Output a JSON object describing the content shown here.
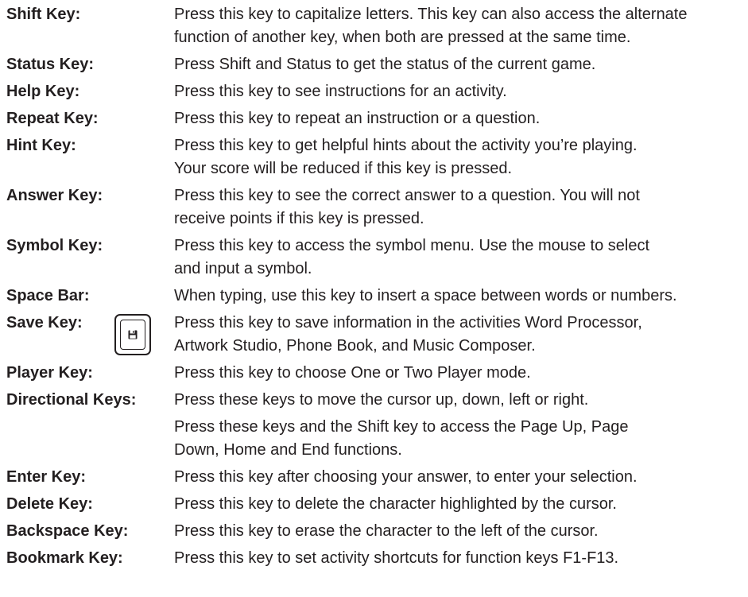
{
  "entries": [
    {
      "term": "Shift Key:",
      "lines": [
        "Press this key to capitalize letters. This key can also access the alternate",
        "function of another key, when both are pressed at the same time."
      ]
    },
    {
      "term": "Status Key:",
      "lines": [
        "Press Shift and Status to get the status of the current game."
      ]
    },
    {
      "term": "Help Key:",
      "lines": [
        "Press this key to see instructions for an activity."
      ]
    },
    {
      "term": "Repeat Key:",
      "lines": [
        "Press this key to repeat an instruction or a question."
      ]
    },
    {
      "term": "Hint Key:",
      "lines": [
        "Press this key to get helpful hints about the activity you’re playing.",
        "Your score will be reduced if this key is pressed."
      ]
    },
    {
      "term": "Answer Key:",
      "lines": [
        "Press this key to see the correct answer to a question. You will not",
        "receive points if this key is pressed."
      ]
    },
    {
      "term": "Symbol Key:",
      "lines": [
        "Press this key to access the symbol menu. Use the mouse to select",
        "and input a symbol."
      ]
    },
    {
      "term": "Space Bar:",
      "lines": [
        "When typing, use this key to insert a space between words or numbers."
      ]
    },
    {
      "term": "Save Key:",
      "lines": [
        "Press this key to save information in the activities Word Processor,",
        "Artwork Studio, Phone Book, and Music Composer."
      ],
      "icon": "floppy-disk-icon"
    },
    {
      "term": "Player Key:",
      "lines": [
        "Press this key to choose One or Two Player mode."
      ]
    },
    {
      "term": "Directional Keys:",
      "lines": [
        "Press these keys to move the cursor up, down, left or right."
      ]
    },
    {
      "term": "",
      "lines": [
        "Press these keys and the Shift key to access the Page Up, Page",
        "Down, Home and End functions."
      ]
    },
    {
      "term": "Enter Key:",
      "lines": [
        "Press this key after choosing your answer, to enter your selection."
      ]
    },
    {
      "term": "Delete Key:",
      "lines": [
        "Press this key to delete the character highlighted by the cursor."
      ]
    },
    {
      "term": "Backspace Key:",
      "lines": [
        "Press this key to erase the character to the left of the cursor."
      ]
    },
    {
      "term": "Bookmark Key:",
      "lines": [
        "Press this key to set activity shortcuts for function keys F1-F13."
      ]
    }
  ]
}
